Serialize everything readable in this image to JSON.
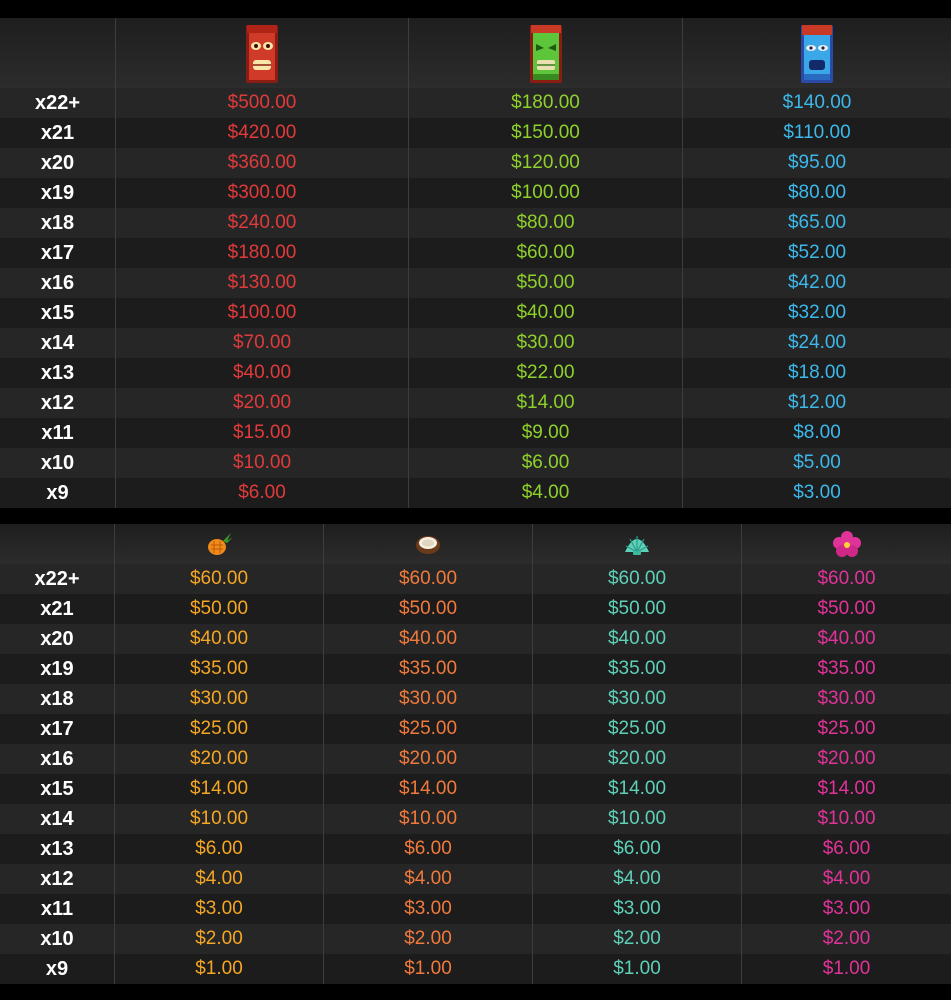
{
  "table1": {
    "row_labels": [
      "x22+",
      "x21",
      "x20",
      "x19",
      "x18",
      "x17",
      "x16",
      "x15",
      "x14",
      "x13",
      "x12",
      "x11",
      "x10",
      "x9"
    ],
    "columns": [
      {
        "icon": "red-tiki-mask-icon",
        "color": "#e03a3a",
        "values": [
          "$500.00",
          "$420.00",
          "$360.00",
          "$300.00",
          "$240.00",
          "$180.00",
          "$130.00",
          "$100.00",
          "$70.00",
          "$40.00",
          "$20.00",
          "$15.00",
          "$10.00",
          "$6.00"
        ]
      },
      {
        "icon": "green-tiki-mask-icon",
        "color": "#8ed12a",
        "values": [
          "$180.00",
          "$150.00",
          "$120.00",
          "$100.00",
          "$80.00",
          "$60.00",
          "$50.00",
          "$40.00",
          "$30.00",
          "$22.00",
          "$14.00",
          "$9.00",
          "$6.00",
          "$4.00"
        ]
      },
      {
        "icon": "blue-tiki-mask-icon",
        "color": "#3cb8ea",
        "values": [
          "$140.00",
          "$110.00",
          "$95.00",
          "$80.00",
          "$65.00",
          "$52.00",
          "$42.00",
          "$32.00",
          "$24.00",
          "$18.00",
          "$12.00",
          "$8.00",
          "$5.00",
          "$3.00"
        ]
      }
    ]
  },
  "table2": {
    "row_labels": [
      "x22+",
      "x21",
      "x20",
      "x19",
      "x18",
      "x17",
      "x16",
      "x15",
      "x14",
      "x13",
      "x12",
      "x11",
      "x10",
      "x9"
    ],
    "columns": [
      {
        "icon": "pineapple-icon",
        "color": "#f5a623",
        "values": [
          "$60.00",
          "$50.00",
          "$40.00",
          "$35.00",
          "$30.00",
          "$25.00",
          "$20.00",
          "$14.00",
          "$10.00",
          "$6.00",
          "$4.00",
          "$3.00",
          "$2.00",
          "$1.00"
        ]
      },
      {
        "icon": "coconut-icon",
        "color": "#f07a3c",
        "values": [
          "$60.00",
          "$50.00",
          "$40.00",
          "$35.00",
          "$30.00",
          "$25.00",
          "$20.00",
          "$14.00",
          "$10.00",
          "$6.00",
          "$4.00",
          "$3.00",
          "$2.00",
          "$1.00"
        ]
      },
      {
        "icon": "seashell-icon",
        "color": "#5fd0b8",
        "values": [
          "$60.00",
          "$50.00",
          "$40.00",
          "$35.00",
          "$30.00",
          "$25.00",
          "$20.00",
          "$14.00",
          "$10.00",
          "$6.00",
          "$4.00",
          "$3.00",
          "$2.00",
          "$1.00"
        ]
      },
      {
        "icon": "hibiscus-flower-icon",
        "color": "#e0339a",
        "values": [
          "$60.00",
          "$50.00",
          "$40.00",
          "$35.00",
          "$30.00",
          "$25.00",
          "$20.00",
          "$14.00",
          "$10.00",
          "$6.00",
          "$4.00",
          "$3.00",
          "$2.00",
          "$1.00"
        ]
      }
    ]
  }
}
